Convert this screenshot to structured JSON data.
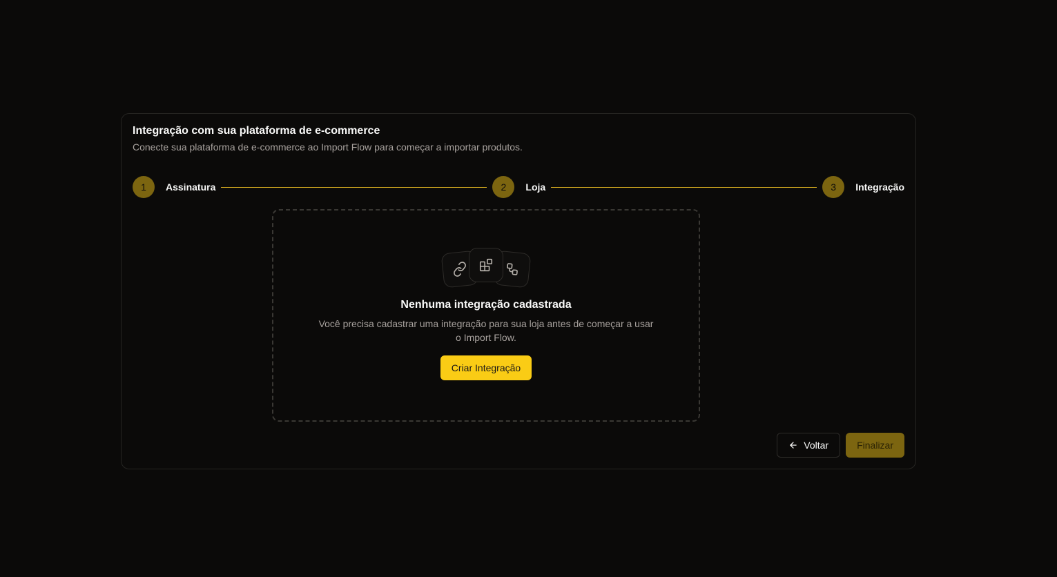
{
  "card": {
    "title": "Integração com sua plataforma de e-commerce",
    "description": "Conecte sua plataforma de e-commerce ao Import Flow para começar a importar produtos."
  },
  "stepper": {
    "steps": [
      {
        "number": "1",
        "label": "Assinatura"
      },
      {
        "number": "2",
        "label": "Loja"
      },
      {
        "number": "3",
        "label": "Integração"
      }
    ],
    "accent_color": "#facc15",
    "circle_color": "#7c6510"
  },
  "empty_state": {
    "icons": [
      "link-icon",
      "blocks-icon",
      "shapes-icon"
    ],
    "title": "Nenhuma integração cadastrada",
    "description": "Você precisa cadastrar uma integração para sua loja antes de começar a usar o Import Flow.",
    "create_button": "Criar Integração"
  },
  "footer": {
    "back_label": "Voltar",
    "back_icon": "arrow-left-icon",
    "finish_label": "Finalizar"
  }
}
